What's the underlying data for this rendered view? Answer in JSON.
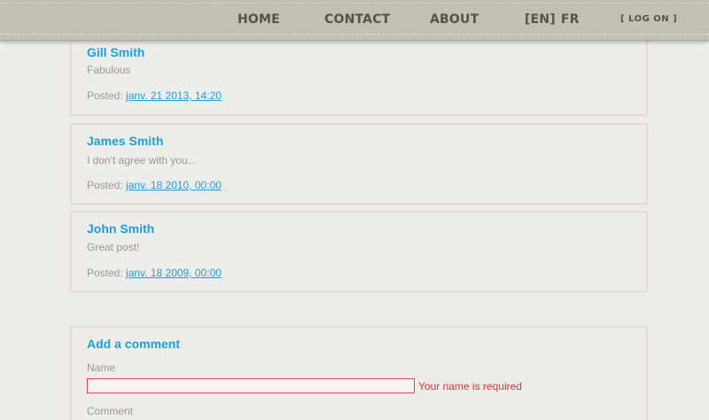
{
  "nav": {
    "home": "HOME",
    "contact": "CONTACT",
    "about": "ABOUT",
    "lang_en": "[EN]",
    "lang_fr": "FR",
    "logon": "[ LOG ON ]"
  },
  "comments": [
    {
      "author": "Gill Smith",
      "text": "Fabulous",
      "posted_label": "Posted:",
      "date": "janv. 21 2013, 14:20"
    },
    {
      "author": "James Smith",
      "text": "I don't agree with you...",
      "posted_label": "Posted:",
      "date": "janv. 18 2010, 00:00"
    },
    {
      "author": "John Smith",
      "text": "Great post!",
      "posted_label": "Posted:",
      "date": "janv. 18 2009, 00:00"
    }
  ],
  "form": {
    "title": "Add a comment",
    "name_label": "Name",
    "name_value": "",
    "name_error": "Your name is required",
    "comment_label": "Comment"
  },
  "colors": {
    "accent": "#1a9fe0",
    "error": "#e0303a",
    "nav_bg": "#c2bfb5",
    "page_bg": "#efedea"
  }
}
